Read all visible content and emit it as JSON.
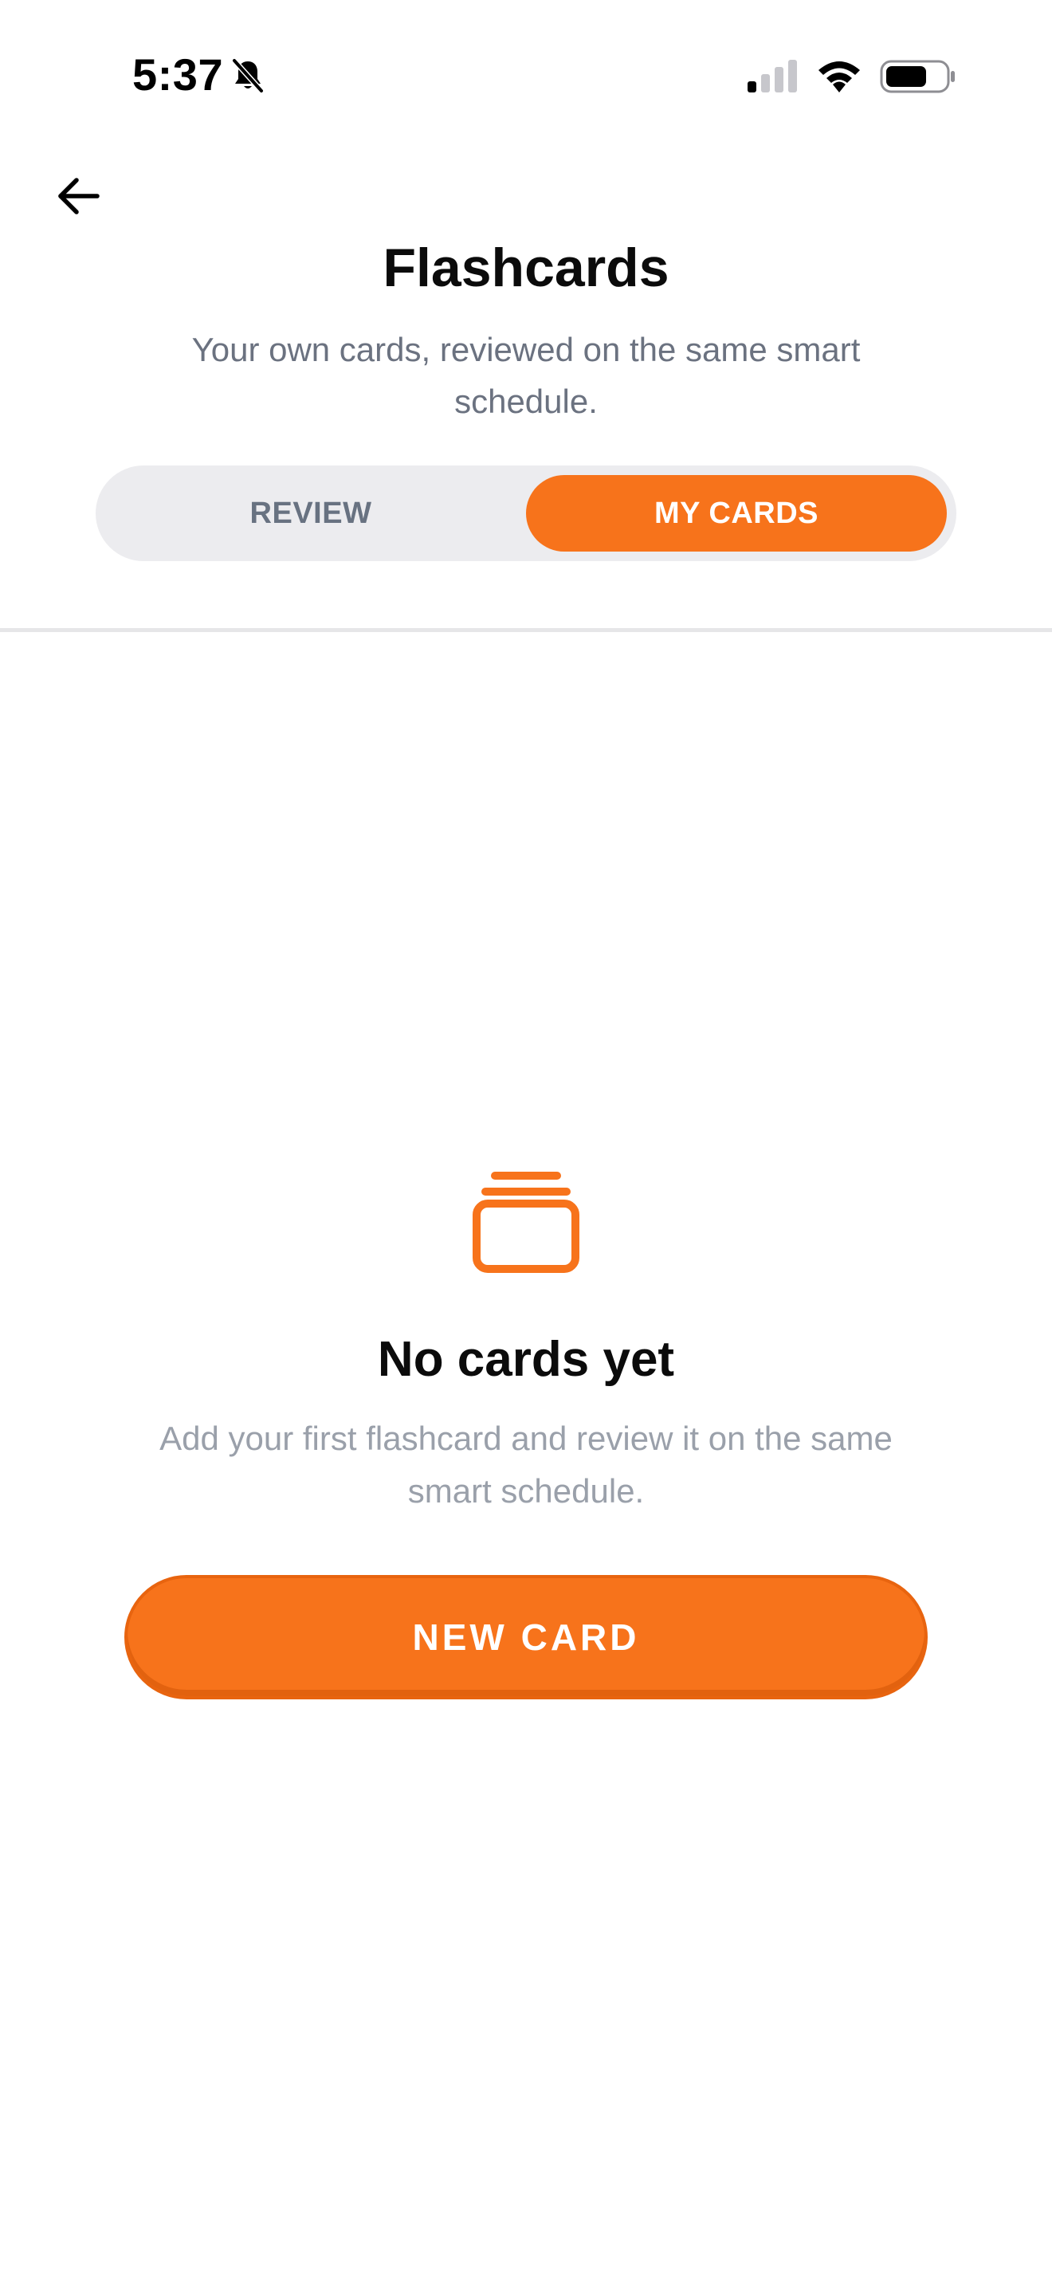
{
  "status_bar": {
    "time": "5:37",
    "icons": [
      "bell-slash-icon",
      "cellular-signal-icon",
      "wifi-icon",
      "battery-icon"
    ]
  },
  "header": {
    "back_icon": "arrow-left-icon",
    "title": "Flashcards",
    "subtitle": "Your own cards, reviewed on the same smart schedule."
  },
  "tabs": {
    "items": [
      {
        "label": "REVIEW",
        "selected": false
      },
      {
        "label": "MY CARDS",
        "selected": true
      }
    ]
  },
  "empty_state": {
    "icon": "card-stack-icon",
    "title": "No cards yet",
    "text": "Add your first flashcard and review it on the same smart schedule."
  },
  "actions": {
    "new_card_label": "NEW CARD"
  },
  "colors": {
    "accent": "#f7731b",
    "segment_bg": "#ececef",
    "title": "#0b0b0b",
    "subtitle": "#6b7280",
    "muted": "#9aa0aa"
  }
}
